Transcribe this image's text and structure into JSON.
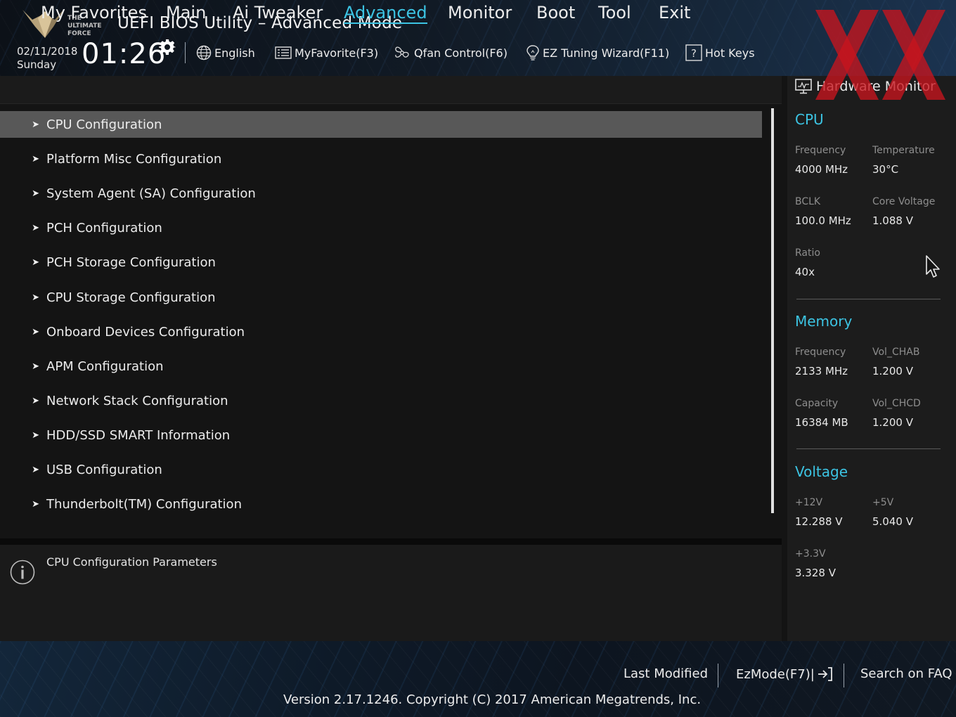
{
  "header": {
    "title": "UEFI BIOS Utility – Advanced Mode",
    "logo_text": "THE ULTIMATE FORCE",
    "date": "02/11/2018",
    "day": "Sunday",
    "time": "01:26",
    "tools": [
      {
        "label": "English",
        "icon": "globe-icon"
      },
      {
        "label": "MyFavorite(F3)",
        "icon": "favorite-list-icon"
      },
      {
        "label": "Qfan Control(F6)",
        "icon": "fan-icon"
      },
      {
        "label": "EZ Tuning Wizard(F11)",
        "icon": "lightbulb-icon"
      },
      {
        "label": "Hot Keys",
        "icon": "help-box-icon"
      }
    ]
  },
  "nav": {
    "tabs": [
      "My Favorites",
      "Main",
      "Ai Tweaker",
      "Advanced",
      "Monitor",
      "Boot",
      "Tool",
      "Exit"
    ],
    "active": "Advanced"
  },
  "menu": {
    "items": [
      "CPU Configuration",
      "Platform Misc Configuration",
      "System Agent (SA) Configuration",
      "PCH Configuration",
      "PCH Storage Configuration",
      "CPU Storage Configuration",
      "Onboard Devices Configuration",
      "APM Configuration",
      "Network Stack Configuration",
      "HDD/SSD SMART Information",
      "USB Configuration",
      "Thunderbolt(TM) Configuration"
    ],
    "selected_index": 0
  },
  "help": {
    "text": "CPU Configuration Parameters"
  },
  "hardware_monitor": {
    "title": "Hardware Monitor",
    "cpu": {
      "heading": "CPU",
      "frequency_label": "Frequency",
      "frequency": "4000 MHz",
      "temperature_label": "Temperature",
      "temperature": "30°C",
      "bclk_label": "BCLK",
      "bclk": "100.0 MHz",
      "core_voltage_label": "Core Voltage",
      "core_voltage": "1.088 V",
      "ratio_label": "Ratio",
      "ratio": "40x"
    },
    "memory": {
      "heading": "Memory",
      "frequency_label": "Frequency",
      "frequency": "2133 MHz",
      "vol_chab_label": "Vol_CHAB",
      "vol_chab": "1.200 V",
      "capacity_label": "Capacity",
      "capacity": "16384 MB",
      "vol_chcd_label": "Vol_CHCD",
      "vol_chcd": "1.200 V"
    },
    "voltage": {
      "heading": "Voltage",
      "v12_label": "+12V",
      "v12": "12.288 V",
      "v5_label": "+5V",
      "v5": "5.040 V",
      "v33_label": "+3.3V",
      "v33": "3.328 V"
    }
  },
  "footer": {
    "last_modified": "Last Modified",
    "ezmode": "EzMode(F7)|",
    "search_faq": "Search on FAQ",
    "version": "Version 2.17.1246. Copyright (C) 2017 American Megatrends, Inc."
  },
  "colors": {
    "accent": "#3cc4e3",
    "selected_row": "#585858",
    "background": "#141414",
    "watermark": "#c8141e"
  }
}
